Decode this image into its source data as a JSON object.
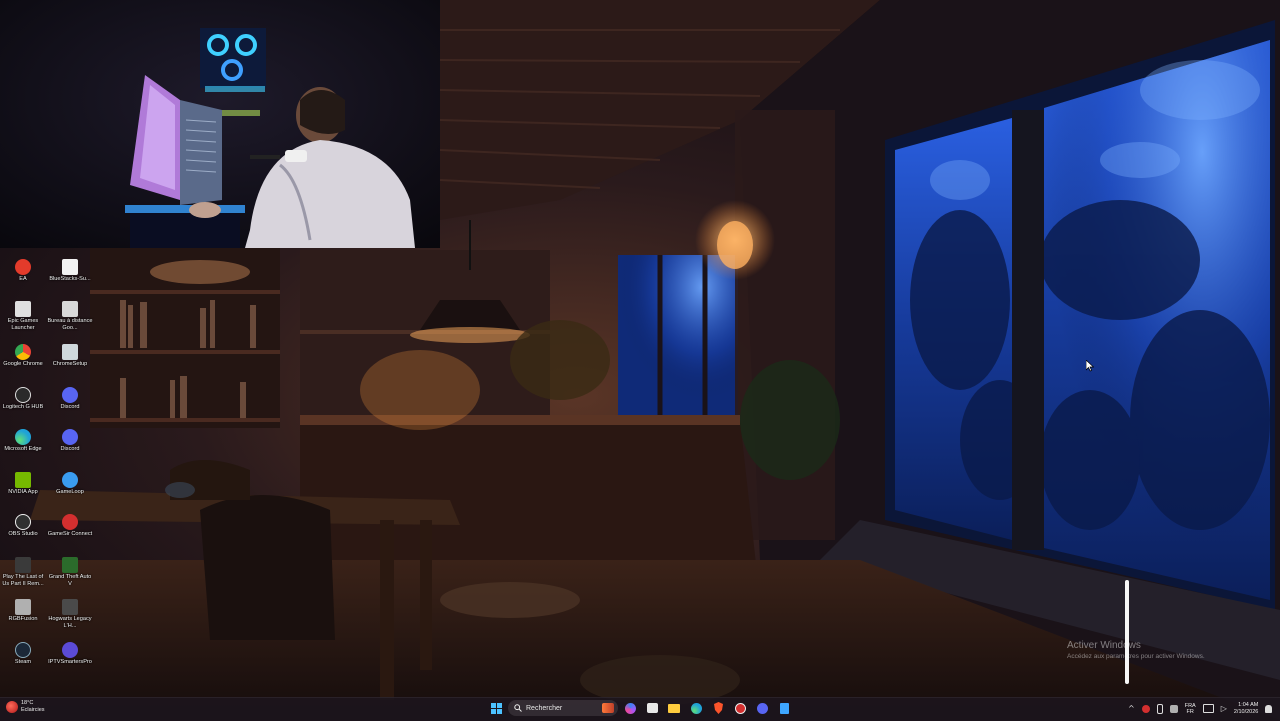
{
  "desktop": {
    "icons": [
      {
        "label": "EA",
        "color": "#e33b2b"
      },
      {
        "label": "BlueStacks-Su...",
        "color": "#f2f2f2"
      },
      {
        "label": "Epic Games Launcher",
        "color": "#e0e0e0"
      },
      {
        "label": "Bureau à distance Goo...",
        "color": "#d8d8d8"
      },
      {
        "label": "Google Chrome",
        "color": "#f4b400"
      },
      {
        "label": "ChromeSetup",
        "color": "#cfd8dc"
      },
      {
        "label": "Logitech G HUB",
        "color": "#2a2a2a"
      },
      {
        "label": "Discord",
        "color": "#5865f2"
      },
      {
        "label": "Microsoft Edge",
        "color": "#1fa2d8"
      },
      {
        "label": "Discord",
        "color": "#5865f2"
      },
      {
        "label": "NVIDIA App",
        "color": "#76b900"
      },
      {
        "label": "GameLoop",
        "color": "#3a9cf0"
      },
      {
        "label": "OBS Studio",
        "color": "#303030"
      },
      {
        "label": "GameSir Connect",
        "color": "#d32f2f"
      },
      {
        "label": "Play The Last of Us Part II Rem...",
        "color": "#3a3a3a"
      },
      {
        "label": "Grand Theft Auto V",
        "color": "#2b6b2b"
      },
      {
        "label": "RGBFusion",
        "color": "#b0b0b0"
      },
      {
        "label": "Hogwarts Legacy L'H...",
        "color": "#4a4a4a"
      },
      {
        "label": "Steam",
        "color": "#1b2838"
      },
      {
        "label": "IPTVSmartersPro",
        "color": "#5b4bd6"
      }
    ]
  },
  "watermark": {
    "title": "Activer Windows",
    "subtitle": "Accédez aux paramètres pour activer Windows."
  },
  "taskbar": {
    "weather": {
      "temp": "18°C",
      "condition": "Eclaircies"
    },
    "search_placeholder": "Rechercher",
    "pinned_icons": [
      "windows-start-icon",
      "game-app-icon",
      "copilot-icon",
      "store-icon",
      "file-explorer-icon",
      "edge-icon",
      "brave-icon",
      "gamesir-icon",
      "discord-icon",
      "notepad-icon"
    ],
    "language": {
      "line1": "FRA",
      "line2": "FR"
    },
    "clock": {
      "time": "1:04 AM",
      "date": "2/10/2026"
    }
  },
  "colors": {
    "taskbar_bg": "#1c161e",
    "window_glow": "#1a44c8",
    "lamp": "#ffb060"
  }
}
